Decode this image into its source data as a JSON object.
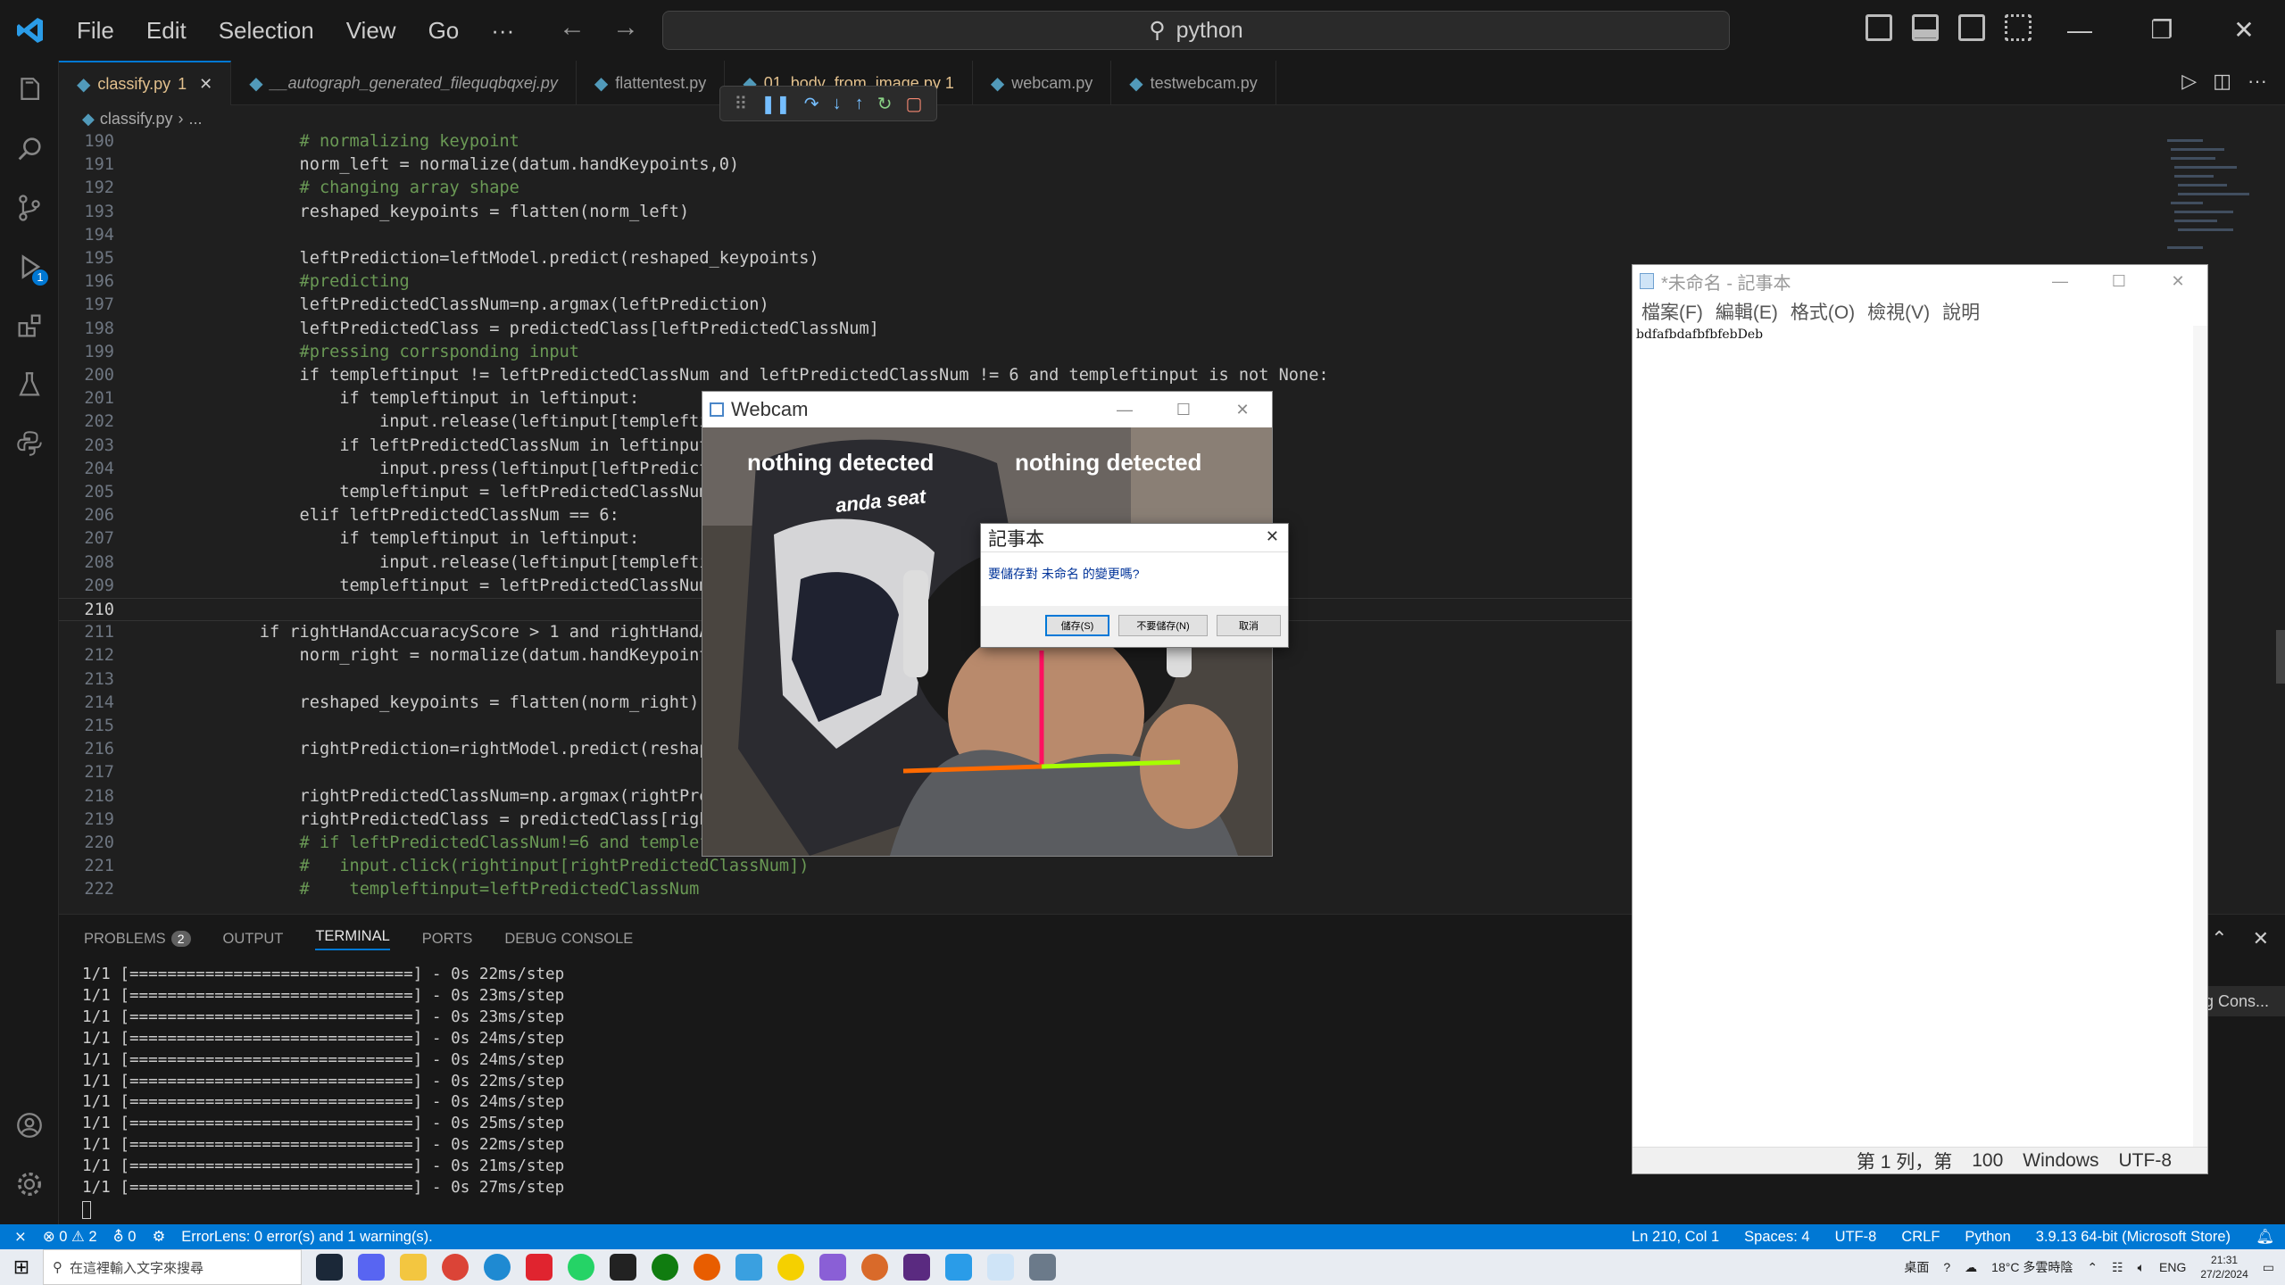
{
  "titlebar": {
    "menu": [
      "File",
      "Edit",
      "Selection",
      "View",
      "Go",
      "···"
    ],
    "search": "python"
  },
  "tabs": [
    {
      "label": "classify.py",
      "suffix": "1",
      "active": true
    },
    {
      "label": "__autograph_generated_filequqbqxej.py"
    },
    {
      "label": "flattentest.py"
    },
    {
      "label": "01_body_from_image.py 1"
    },
    {
      "label": "webcam.py"
    },
    {
      "label": "testwebcam.py"
    }
  ],
  "breadcrumb": [
    "classify.py",
    "..."
  ],
  "editor": {
    "current_line": "210",
    "lines": [
      {
        "n": "190",
        "t": "        # normalizing keypoint",
        "c": "#6a9955"
      },
      {
        "n": "191",
        "t": "        norm_left = normalize(datum.handKeypoints,0)"
      },
      {
        "n": "192",
        "t": "        # changing array shape",
        "c": "#6a9955"
      },
      {
        "n": "193",
        "t": "        reshaped_keypoints = flatten(norm_left)"
      },
      {
        "n": "194",
        "t": ""
      },
      {
        "n": "195",
        "t": "        leftPrediction=leftModel.predict(reshaped_keypoints)"
      },
      {
        "n": "196",
        "t": "        #predicting",
        "c": "#6a9955"
      },
      {
        "n": "197",
        "t": "        leftPredictedClassNum=np.argmax(leftPrediction)"
      },
      {
        "n": "198",
        "t": "        leftPredictedClass = predictedClass[leftPredictedClassNum]"
      },
      {
        "n": "199",
        "t": "        #pressing corrsponding input",
        "c": "#6a9955"
      },
      {
        "n": "200",
        "t": "        if templeftinput != leftPredictedClassNum and leftPredictedClassNum != 6 and templeftinput is not None:"
      },
      {
        "n": "201",
        "t": "            if templeftinput in leftinput:"
      },
      {
        "n": "202",
        "t": "                input.release(leftinput[templeftinput])"
      },
      {
        "n": "203",
        "t": "            if leftPredictedClassNum in leftinput:"
      },
      {
        "n": "204",
        "t": "                input.press(leftinput[leftPredictedClassNum])"
      },
      {
        "n": "205",
        "t": "            templeftinput = leftPredictedClassNum  # Update"
      },
      {
        "n": "206",
        "t": "        elif leftPredictedClassNum == 6:"
      },
      {
        "n": "207",
        "t": "            if templeftinput in leftinput:"
      },
      {
        "n": "208",
        "t": "                input.release(leftinput[templeftinput])"
      },
      {
        "n": "209",
        "t": "            templeftinput = leftPredictedClassNum  # Update"
      },
      {
        "n": "210",
        "t": ""
      },
      {
        "n": "211",
        "t": "    if rightHandAccuaracyScore > 1 and rightHandAccuaracyScore!=None:"
      },
      {
        "n": "212",
        "t": "        norm_right = normalize(datum.handKeypoints,1)"
      },
      {
        "n": "213",
        "t": ""
      },
      {
        "n": "214",
        "t": "        reshaped_keypoints = flatten(norm_right)"
      },
      {
        "n": "215",
        "t": ""
      },
      {
        "n": "216",
        "t": "        rightPrediction=rightModel.predict(reshaped_keypoints)"
      },
      {
        "n": "217",
        "t": ""
      },
      {
        "n": "218",
        "t": "        rightPredictedClassNum=np.argmax(rightPrediction)"
      },
      {
        "n": "219",
        "t": "        rightPredictedClass = predictedClass[rightPredictedClassNum]"
      },
      {
        "n": "220",
        "t": "        # if leftPredictedClassNum!=6 and templeftinput!=leftPredictedClassNum:",
        "c": "#6a9955"
      },
      {
        "n": "221",
        "t": "        #   input.click(rightinput[rightPredictedClassNum])",
        "c": "#6a9955"
      },
      {
        "n": "222",
        "t": "        #    templeftinput=leftPredictedClassNum",
        "c": "#6a9955"
      }
    ]
  },
  "panel": {
    "tabs": [
      "PROBLEMS",
      "OUTPUT",
      "TERMINAL",
      "PORTS",
      "DEBUG CONSOLE"
    ],
    "problems_count": "2",
    "active_tab": "TERMINAL",
    "side_console": "g Cons...",
    "terminal_lines": [
      "1/1 [==============================] - 0s 22ms/step",
      "1/1 [==============================] - 0s 23ms/step",
      "1/1 [==============================] - 0s 23ms/step",
      "1/1 [==============================] - 0s 24ms/step",
      "1/1 [==============================] - 0s 24ms/step",
      "1/1 [==============================] - 0s 22ms/step",
      "1/1 [==============================] - 0s 24ms/step",
      "1/1 [==============================] - 0s 25ms/step",
      "1/1 [==============================] - 0s 22ms/step",
      "1/1 [==============================] - 0s 21ms/step",
      "1/1 [==============================] - 0s 27ms/step"
    ]
  },
  "statusbar": {
    "errors": "0",
    "warnings": "2",
    "ports": "0",
    "errorlens": "ErrorLens: 0 error(s) and 1 warning(s).",
    "position": "Ln 210, Col 1",
    "spaces": "Spaces: 4",
    "encoding": "UTF-8",
    "eol": "CRLF",
    "language": "Python",
    "interpreter": "3.9.13 64-bit (Microsoft Store)"
  },
  "webcam": {
    "title": "Webcam",
    "overlay_left": "nothing detected",
    "overlay_right": "nothing detected",
    "chair_text": "anda seat"
  },
  "dialog": {
    "title": "記事本",
    "message": "要儲存對 未命名 的變更嗎?",
    "save": "儲存(S)",
    "dont_save": "不要儲存(N)",
    "cancel": "取消"
  },
  "notepad": {
    "title": "*未命名 - 記事本",
    "menu": [
      "檔案(F)",
      "編輯(E)",
      "格式(O)",
      "檢視(V)",
      "說明"
    ],
    "content": "bdfafbdafbfbfebDeb",
    "status_pos": "第 1 列，第",
    "zoom": "100",
    "eol": "Windows",
    "encoding": "UTF-8"
  },
  "taskbar": {
    "search_placeholder": "在這裡輸入文字來搜尋",
    "desktop": "桌面",
    "weather": "18°C 多雲時陰",
    "lang": "ENG",
    "time": "21:31",
    "date": "27/2/2024"
  }
}
